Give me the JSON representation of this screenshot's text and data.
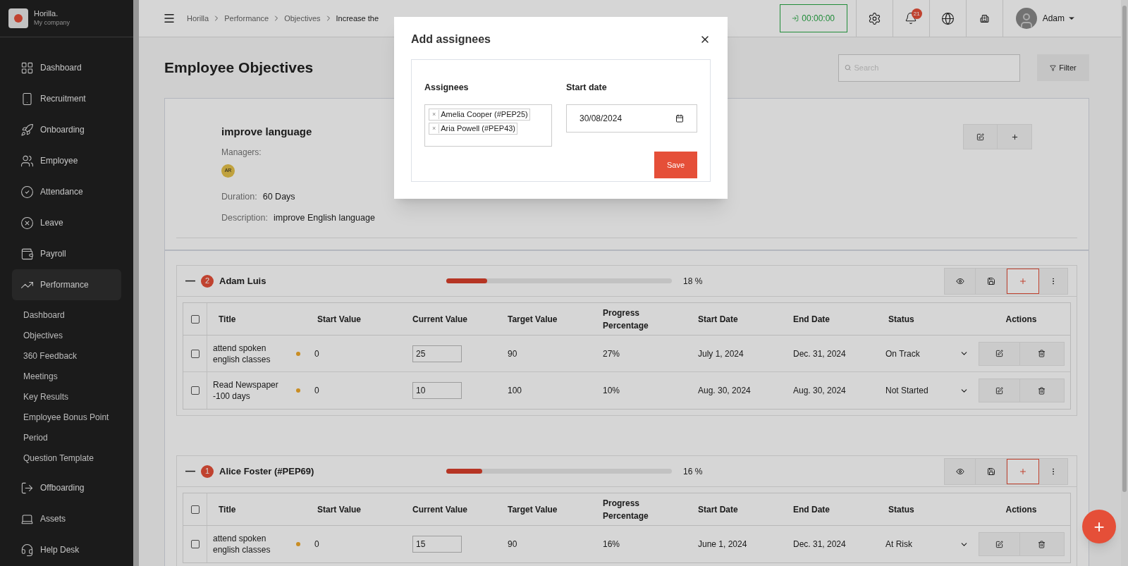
{
  "brand": {
    "name": "Horilla.",
    "company": "My company"
  },
  "sidebar": {
    "items": [
      {
        "label": "Dashboard",
        "selected": false
      },
      {
        "label": "Recruitment",
        "selected": false
      },
      {
        "label": "Onboarding",
        "selected": false
      },
      {
        "label": "Employee",
        "selected": false
      },
      {
        "label": "Attendance",
        "selected": false
      },
      {
        "label": "Leave",
        "selected": false
      },
      {
        "label": "Payroll",
        "selected": false
      },
      {
        "label": "Performance",
        "selected": true,
        "children": [
          "Dashboard",
          "Objectives",
          "360 Feedback",
          "Meetings",
          "Key Results",
          "Employee Bonus Point",
          "Period",
          "Question Template"
        ]
      },
      {
        "label": "Offboarding",
        "selected": false
      },
      {
        "label": "Assets",
        "selected": false
      },
      {
        "label": "Help Desk",
        "selected": false
      }
    ]
  },
  "topbar": {
    "breadcrumb": [
      "Horilla",
      "Performance",
      "Objectives",
      "Increase the"
    ],
    "timer": "00:00:00",
    "notifications": "21",
    "user": "Adam"
  },
  "page": {
    "title": "Employee Objectives",
    "search": {
      "placeholder": "Search"
    },
    "filter": "Filter"
  },
  "objective": {
    "title": "improve language",
    "managers_label": "Managers:",
    "managers": [
      "AR"
    ],
    "duration_label": "Duration:",
    "duration": "60 Days",
    "description_label": "Description:",
    "description": "improve English language"
  },
  "groups": [
    {
      "toggle": "—",
      "name": "Adam Luis",
      "count": "2",
      "level": 0.18,
      "percent": "18 %",
      "expanded": true,
      "all_checked": false,
      "columns": [
        "Title",
        "Start Value",
        "Current Value",
        "Target Value",
        "Progress Percentage",
        "Start Date",
        "End Date",
        "Status",
        "Actions"
      ],
      "rows": [
        {
          "title": "attend spoken english classes",
          "start": "0",
          "current": "25",
          "target": "90",
          "progress": "27%",
          "start_date": "July 1, 2024",
          "end_date": "Dec. 31, 2024",
          "status": "On Track",
          "checked": false
        },
        {
          "title": "Read Newspaper -100 days",
          "start": "0",
          "current": "10",
          "target": "100",
          "progress": "10%",
          "start_date": "Aug. 30, 2024",
          "end_date": "Aug. 30, 2024",
          "status": "Not Started",
          "checked": false
        }
      ]
    },
    {
      "toggle": "—",
      "name": "Alice Foster (#PEP69)",
      "count": "1",
      "level": 0.16,
      "percent": "16 %",
      "expanded": true,
      "all_checked": false,
      "columns": [
        "Title",
        "Start Value",
        "Current Value",
        "Target Value",
        "Progress Percentage",
        "Start Date",
        "End Date",
        "Status",
        "Actions"
      ],
      "rows": [
        {
          "title": "attend spoken english classes",
          "start": "0",
          "current": "15",
          "target": "90",
          "progress": "16%",
          "start_date": "June 1, 2024",
          "end_date": "Dec. 31, 2024",
          "status": "At Risk",
          "checked": false
        }
      ]
    }
  ],
  "modal": {
    "title": "Add assignees",
    "assignees_label": "Assignees",
    "assignees": [
      {
        "remove": "×",
        "name": "Amelia Cooper (#PEP25)"
      },
      {
        "remove": "×",
        "name": "Aria Powell (#PEP43)"
      }
    ],
    "start_label": "Start date",
    "start_date": "30/08/2024",
    "save": "Save"
  },
  "fab": "+"
}
